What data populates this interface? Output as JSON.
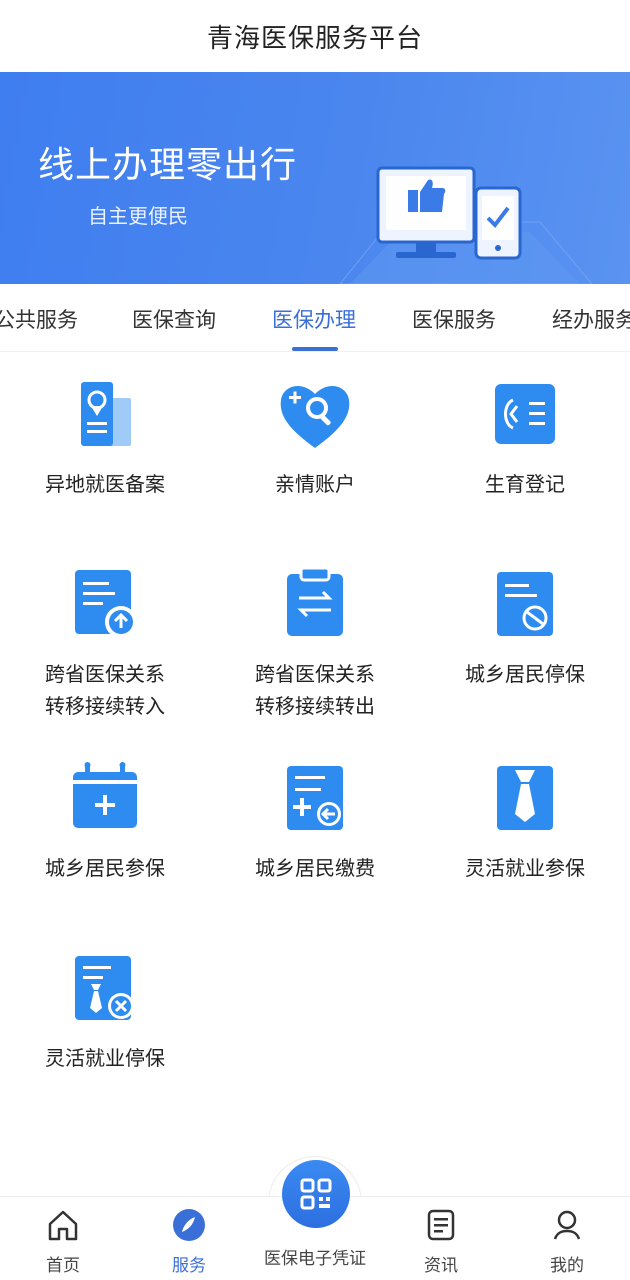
{
  "header": {
    "title": "青海医保服务平台"
  },
  "banner": {
    "title": "线上办理零出行",
    "subtitle": "自主更便民"
  },
  "tabs": [
    {
      "label": "公共服务"
    },
    {
      "label": "医保查询"
    },
    {
      "label": "医保办理",
      "active": true
    },
    {
      "label": "医保服务"
    },
    {
      "label": "经办服务"
    }
  ],
  "services": [
    {
      "label": "异地就医备案",
      "icon": "location-document-icon"
    },
    {
      "label": "亲情账户",
      "icon": "heart-search-icon"
    },
    {
      "label": "生育登记",
      "icon": "baby-list-icon"
    },
    {
      "label": "跨省医保关系\n转移接续转入",
      "icon": "document-upload-icon"
    },
    {
      "label": "跨省医保关系\n转移接续转出",
      "icon": "clipboard-transfer-icon"
    },
    {
      "label": "城乡居民停保",
      "icon": "document-stop-icon"
    },
    {
      "label": "城乡居民参保",
      "icon": "calendar-add-icon"
    },
    {
      "label": "城乡居民缴费",
      "icon": "document-payment-icon"
    },
    {
      "label": "灵活就业参保",
      "icon": "tie-icon"
    },
    {
      "label": "灵活就业停保",
      "icon": "tie-cancel-icon"
    }
  ],
  "bottom_nav": {
    "home": "首页",
    "service": "服务",
    "qr": "医保电子凭证",
    "news": "资讯",
    "mine": "我的"
  },
  "colors": {
    "primary": "#3b6fd8",
    "icon_blue": "#2e8cf0",
    "banner": "#4a86ee"
  }
}
